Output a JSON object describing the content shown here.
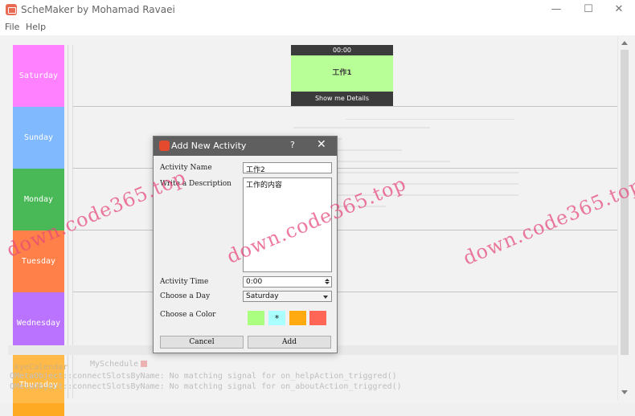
{
  "window": {
    "title": "ScheMaker by Mohamad Ravaei",
    "minimize_glyph": "—",
    "maximize_glyph": "☐",
    "close_glyph": "✕"
  },
  "menu": {
    "file": "File",
    "help": "Help"
  },
  "days": [
    {
      "label": "Saturday",
      "color": "#ff66ff"
    },
    {
      "label": "Sunday",
      "color": "#66aaff"
    },
    {
      "label": "Monday",
      "color": "#22aa33"
    },
    {
      "label": "Tuesday",
      "color": "#ff6622"
    },
    {
      "label": "Wednesday",
      "color": "#aa55ff"
    },
    {
      "label": "Thursday",
      "color": "#ffaa22"
    }
  ],
  "activity_card": {
    "time": "00:00",
    "title": "工作1",
    "details_button": "Show me Details",
    "color": "#aaff80"
  },
  "background": {
    "tab_calendar": "kyeCalendar",
    "tab_schedule": "MySchedule",
    "log_line_1": "QMetaObject::connectSlotsByName: No matching signal for on_helpAction_triggred()",
    "log_line_2": "QMetaObject::connectSlotsByName: No matching signal for on_aboutAction_triggred()"
  },
  "dialog": {
    "title": "Add New Activity",
    "help_glyph": "?",
    "close_glyph": "✕",
    "name_label": "Activity Name",
    "name_value": "工作2",
    "desc_label": "Write a Description",
    "desc_value": "工作的内容",
    "time_label": "Activity Time",
    "time_value": "0:00",
    "day_label": "Choose a Day",
    "day_value": "Saturday",
    "color_label": "Choose a Color",
    "colors": [
      {
        "hex": "#aaff80",
        "mark": ""
      },
      {
        "hex": "#aaffff",
        "mark": "*"
      },
      {
        "hex": "#ffaa11",
        "mark": ""
      },
      {
        "hex": "#ff6655",
        "mark": ""
      }
    ],
    "cancel_label": "Cancel",
    "add_label": "Add"
  },
  "watermarks": [
    "down.code365.top",
    "down.code365.top",
    "down.code365.top"
  ]
}
